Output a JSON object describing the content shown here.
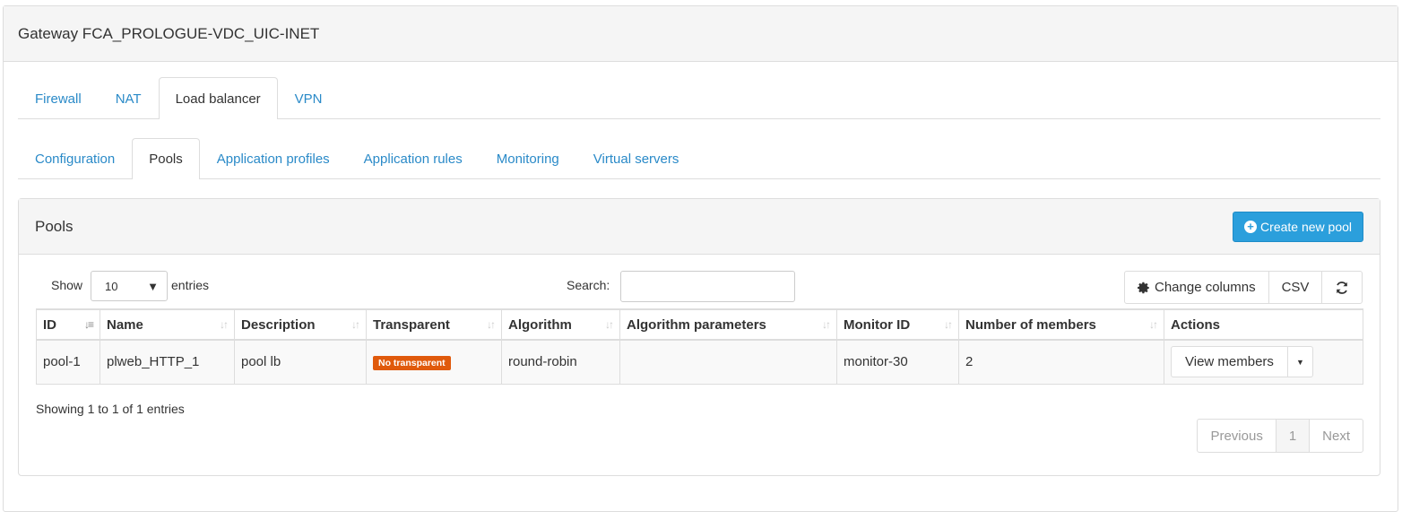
{
  "gateway": {
    "title": "Gateway FCA_PROLOGUE-VDC_UIC-INET"
  },
  "main_tabs": [
    {
      "label": "Firewall"
    },
    {
      "label": "NAT"
    },
    {
      "label": "Load balancer",
      "active": true
    },
    {
      "label": "VPN"
    }
  ],
  "sub_tabs": [
    {
      "label": "Configuration"
    },
    {
      "label": "Pools",
      "active": true
    },
    {
      "label": "Application profiles"
    },
    {
      "label": "Application rules"
    },
    {
      "label": "Monitoring"
    },
    {
      "label": "Virtual servers"
    }
  ],
  "pools_panel": {
    "title": "Pools",
    "create_button": "Create new pool",
    "create_icon": "plus-circle-icon"
  },
  "controls": {
    "show_label": "Show",
    "length_value": "10",
    "entries_label": "entries",
    "search_label": "Search:",
    "search_value": "",
    "change_columns": "Change columns",
    "change_columns_icon": "gear-icon",
    "csv": "CSV",
    "refresh_icon": "refresh-icon"
  },
  "table": {
    "columns": [
      "ID",
      "Name",
      "Description",
      "Transparent",
      "Algorithm",
      "Algorithm parameters",
      "Monitor ID",
      "Number of members",
      "Actions"
    ],
    "rows": [
      {
        "id": "pool-1",
        "name": "plweb_HTTP_1",
        "description": "pool lb",
        "transparent": "No transparent",
        "algorithm": "round-robin",
        "algorithm_parameters": "",
        "monitor_id": "monitor-30",
        "members": "2",
        "action": "View members"
      }
    ]
  },
  "footer": {
    "info": "Showing 1 to 1 of 1 entries",
    "previous": "Previous",
    "page": "1",
    "next": "Next"
  },
  "colors": {
    "link": "#2a8ac8",
    "primary": "#2b9fdc",
    "warning_badge": "#e05a0c"
  }
}
